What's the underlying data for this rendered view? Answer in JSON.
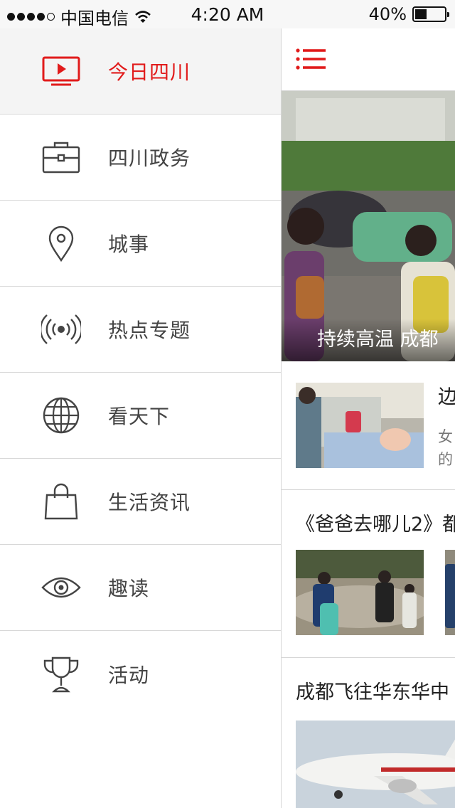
{
  "status_bar": {
    "carrier": "中国电信",
    "time": "4:20 AM",
    "battery_percent": "40%",
    "battery_level": 0.4
  },
  "colors": {
    "accent": "#e11b1b",
    "divider": "#d8d8d8",
    "active_bg": "#f4f4f4"
  },
  "drawer": {
    "items": [
      {
        "label": "今日四川",
        "icon": "tv-play-icon",
        "active": true
      },
      {
        "label": "四川政务",
        "icon": "briefcase-icon",
        "active": false
      },
      {
        "label": "城事",
        "icon": "location-pin-icon",
        "active": false
      },
      {
        "label": "热点专题",
        "icon": "broadcast-icon",
        "active": false
      },
      {
        "label": "看天下",
        "icon": "globe-icon",
        "active": false
      },
      {
        "label": "生活资讯",
        "icon": "shopping-bag-icon",
        "active": false
      },
      {
        "label": "趣读",
        "icon": "eye-icon",
        "active": false
      },
      {
        "label": "活动",
        "icon": "trophy-icon",
        "active": false
      }
    ]
  },
  "content": {
    "menu_icon": "hamburger-menu-icon",
    "hero": {
      "caption": "持续高温 成都"
    },
    "news": [
      {
        "title": "边",
        "summary_lines": [
          "女",
          "的"
        ]
      },
      {
        "title": "《爸爸去哪儿2》都"
      },
      {
        "title": "成都飞往华东华中"
      }
    ]
  }
}
